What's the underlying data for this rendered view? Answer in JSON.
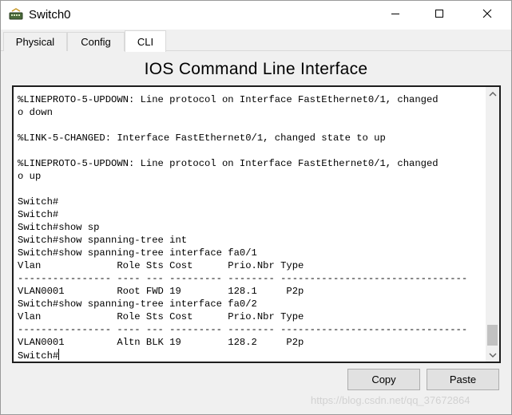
{
  "window": {
    "title": "Switch0"
  },
  "tabs": [
    {
      "label": "Physical"
    },
    {
      "label": "Config"
    },
    {
      "label": "CLI"
    }
  ],
  "active_tab": "CLI",
  "heading": "IOS Command Line Interface",
  "terminal": {
    "lines": [
      "%LINEPROTO-5-UPDOWN: Line protocol on Interface FastEthernet0/1, changed",
      "o down",
      "",
      "%LINK-5-CHANGED: Interface FastEthernet0/1, changed state to up",
      "",
      "%LINEPROTO-5-UPDOWN: Line protocol on Interface FastEthernet0/1, changed",
      "o up",
      "",
      "Switch#",
      "Switch#",
      "Switch#show sp",
      "Switch#show spanning-tree int",
      "Switch#show spanning-tree interface fa0/1",
      "Vlan             Role Sts Cost      Prio.Nbr Type",
      "---------------- ---- --- --------- -------- --------------------------------",
      "VLAN0001         Root FWD 19        128.1     P2p",
      "Switch#show spanning-tree interface fa0/2",
      "Vlan             Role Sts Cost      Prio.Nbr Type",
      "---------------- ---- --- --------- -------- --------------------------------",
      "VLAN0001         Altn BLK 19        128.2     P2p",
      "Switch#"
    ]
  },
  "buttons": {
    "copy": "Copy",
    "paste": "Paste"
  },
  "watermark": "https://blog.csdn.net/qq_37672864",
  "icons": {
    "app": "switch-app-icon",
    "minimize": "minimize-icon",
    "maximize": "maximize-icon",
    "close": "close-icon",
    "scroll_up": "chevron-up-icon",
    "scroll_down": "chevron-down-icon"
  }
}
